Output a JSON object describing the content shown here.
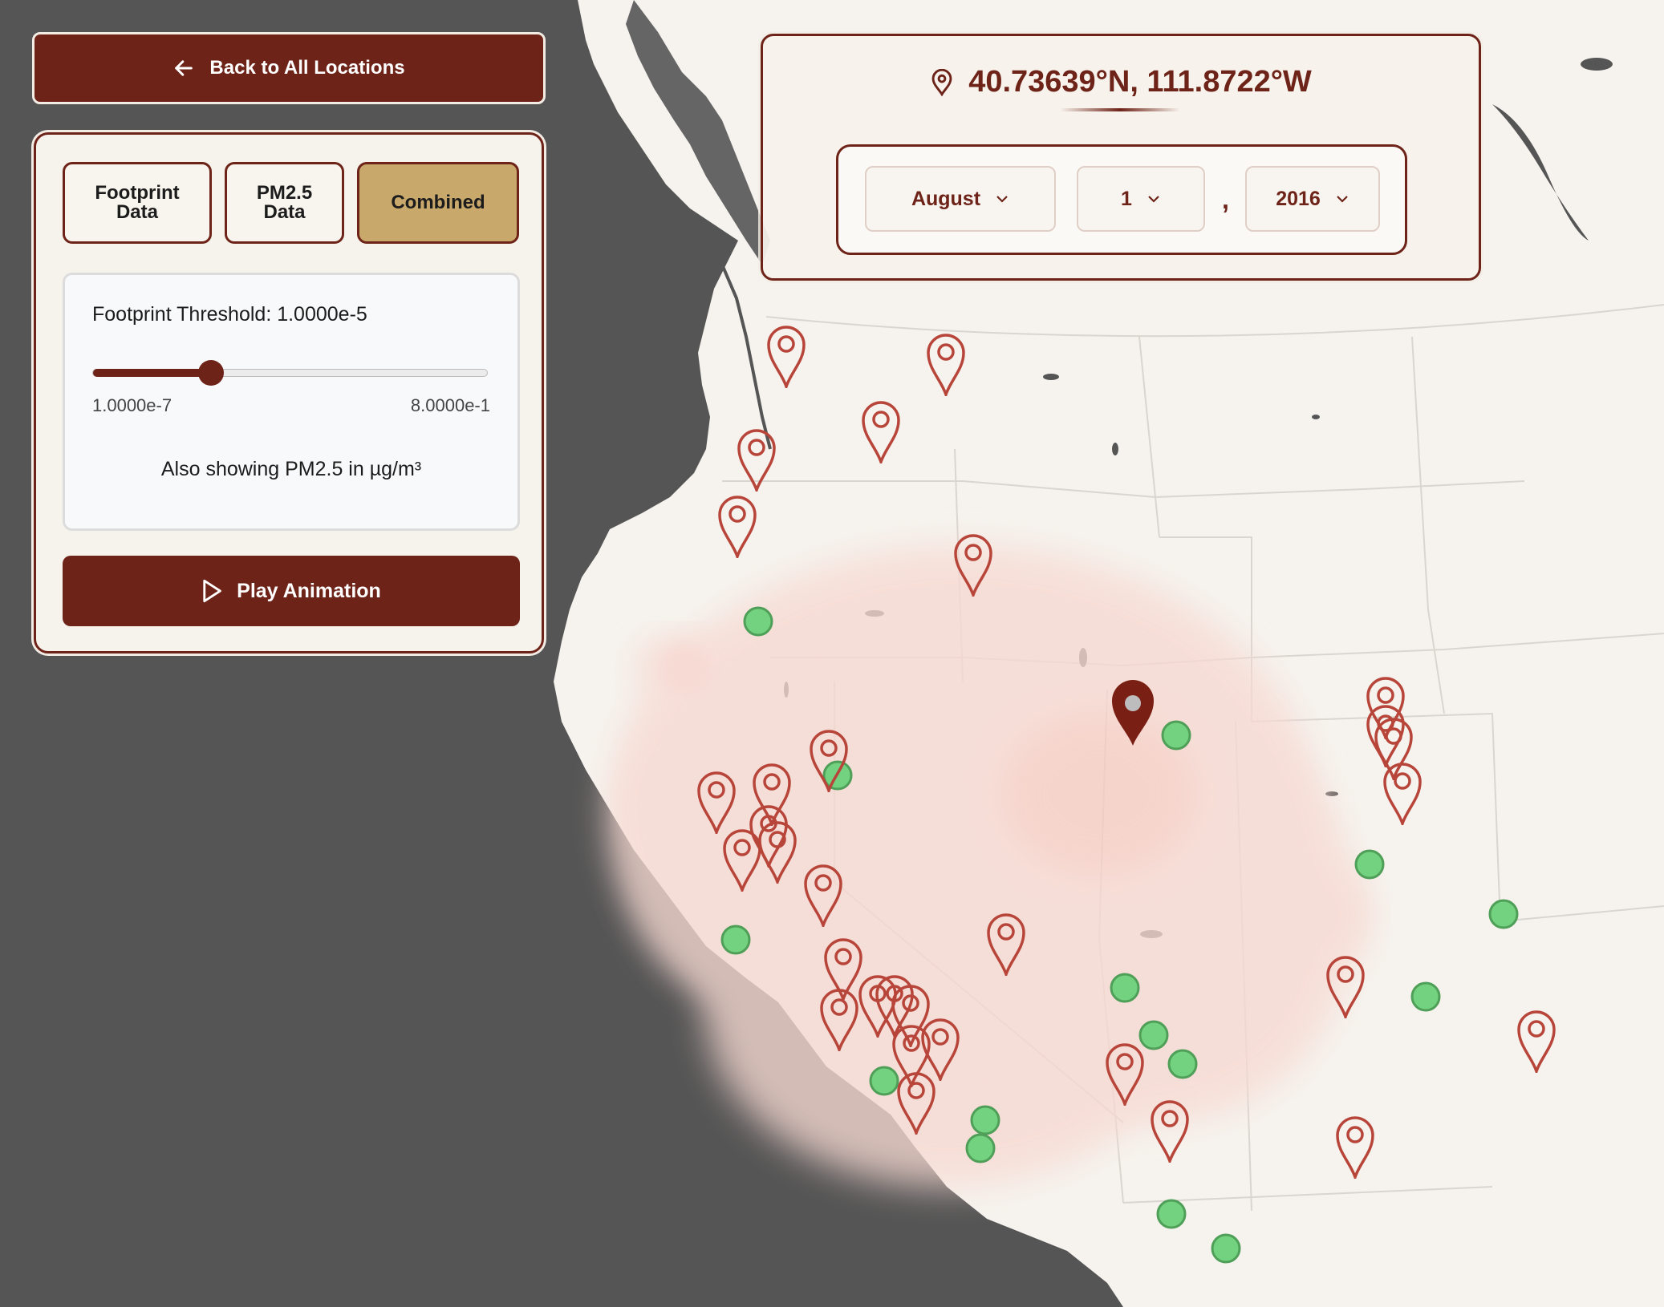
{
  "back_button": {
    "label": "Back to All Locations",
    "icon": "arrow-left-icon"
  },
  "data_tabs": [
    {
      "line1": "Footprint",
      "line2": "Data",
      "active": false
    },
    {
      "line1": "PM2.5",
      "line2": "Data",
      "active": false
    },
    {
      "line1": "Combined",
      "line2": "",
      "active": true
    }
  ],
  "threshold": {
    "label": "Footprint Threshold: 1.0000e-5",
    "min_label": "1.0000e-7",
    "max_label": "8.0000e-1",
    "slider_fraction": 0.3
  },
  "pm25_note": "Also showing PM2.5 in µg/m³",
  "play_button": {
    "label": "Play Animation",
    "icon": "play-icon"
  },
  "location": {
    "coordinates": "40.73639°N, 111.8722°W",
    "icon": "map-pin-icon"
  },
  "date_selector": {
    "month": "August",
    "day": "1",
    "separator": ",",
    "year": "2016"
  },
  "colors": {
    "accent": "#6e2318",
    "tab_active": "#c9a86b",
    "land": "#f6f3ee",
    "water": "#555555",
    "footprint_plume": "#f7d9d2",
    "pm25_marker": "#72d27f",
    "footprint_marker": "#b8453a"
  }
}
